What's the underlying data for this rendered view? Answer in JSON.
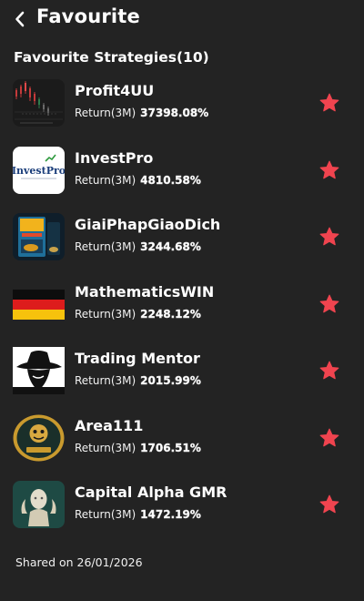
{
  "header": {
    "title": "Favourite"
  },
  "section": {
    "title": "Favourite Strategies(10)"
  },
  "strategies": [
    {
      "name": "Profit4UU",
      "return_label": "Return(3M)",
      "return_value": "37398.08%",
      "thumbnail": "candlestick-chart-thumbnail",
      "favourite": true
    },
    {
      "name": "InvestPro",
      "return_label": "Return(3M)",
      "return_value": "4810.58%",
      "thumbnail": "investpro-logo-thumbnail",
      "thumb_text": "InvestPro",
      "favourite": true
    },
    {
      "name": "GiaiPhapGiaoDich",
      "return_label": "Return(3M)",
      "return_value": "3244.68%",
      "thumbnail": "book-cover-thumbnail",
      "favourite": true
    },
    {
      "name": "MathematicsWIN",
      "return_label": "Return(3M)",
      "return_value": "2248.12%",
      "thumbnail": "german-flag-thumbnail",
      "favourite": true
    },
    {
      "name": "Trading Mentor",
      "return_label": "Return(3M)",
      "return_value": "2015.99%",
      "thumbnail": "hat-silhouette-thumbnail",
      "favourite": true
    },
    {
      "name": "Area111",
      "return_label": "Return(3M)",
      "return_value": "1706.51%",
      "thumbnail": "gold-emblem-thumbnail",
      "favourite": true
    },
    {
      "name": "Capital Alpha GMR",
      "return_label": "Return(3M)",
      "return_value": "1472.19%",
      "thumbnail": "statue-thumbnail",
      "favourite": true
    }
  ],
  "footer": {
    "shared_text": "Shared on 26/01/2026"
  },
  "colors": {
    "background": "#232323",
    "star": "#f0444f",
    "text": "#ffffff"
  }
}
